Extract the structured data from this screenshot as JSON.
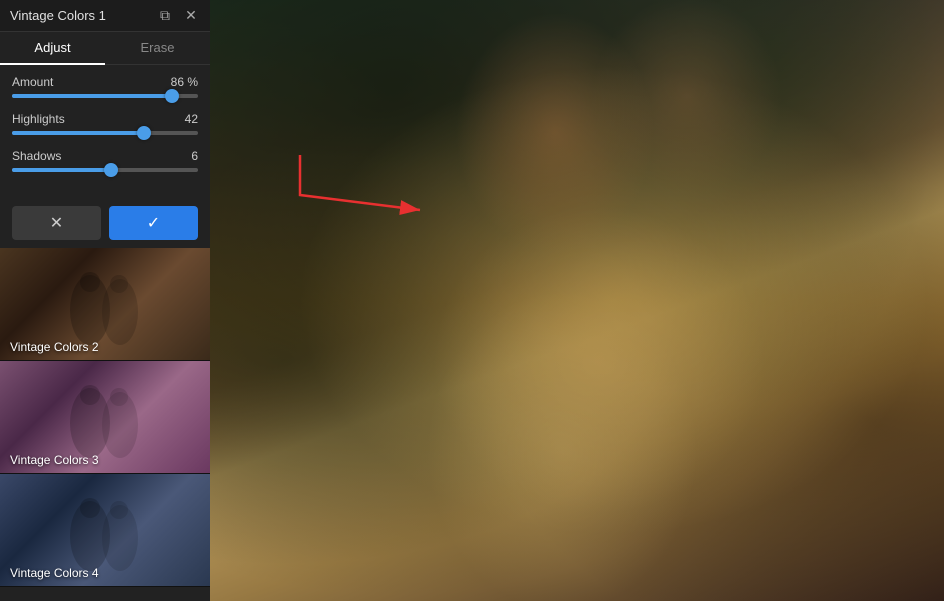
{
  "panel": {
    "title": "Vintage Colors 1",
    "copy_icon": "⧉",
    "close_icon": "✕"
  },
  "tabs": {
    "adjust_label": "Adjust",
    "erase_label": "Erase",
    "active": "adjust"
  },
  "sliders": {
    "amount": {
      "label": "Amount",
      "value": "86 %",
      "percent": 86
    },
    "highlights": {
      "label": "Highlights",
      "value": "42",
      "percent": 71
    },
    "shadows": {
      "label": "Shadows",
      "value": "6",
      "percent": 53
    }
  },
  "buttons": {
    "cancel_icon": "✕",
    "confirm_icon": "✓"
  },
  "filters": [
    {
      "label": "Vintage Colors 2",
      "thumb_class": "thumb-1"
    },
    {
      "label": "Vintage Colors 3",
      "thumb_class": "thumb-3"
    },
    {
      "label": "Vintage Colors 4",
      "thumb_class": "thumb-bottom"
    }
  ],
  "colors": {
    "accent_blue": "#2a7de8",
    "cancel_bg": "#3a3a3a",
    "panel_bg": "#222222"
  }
}
